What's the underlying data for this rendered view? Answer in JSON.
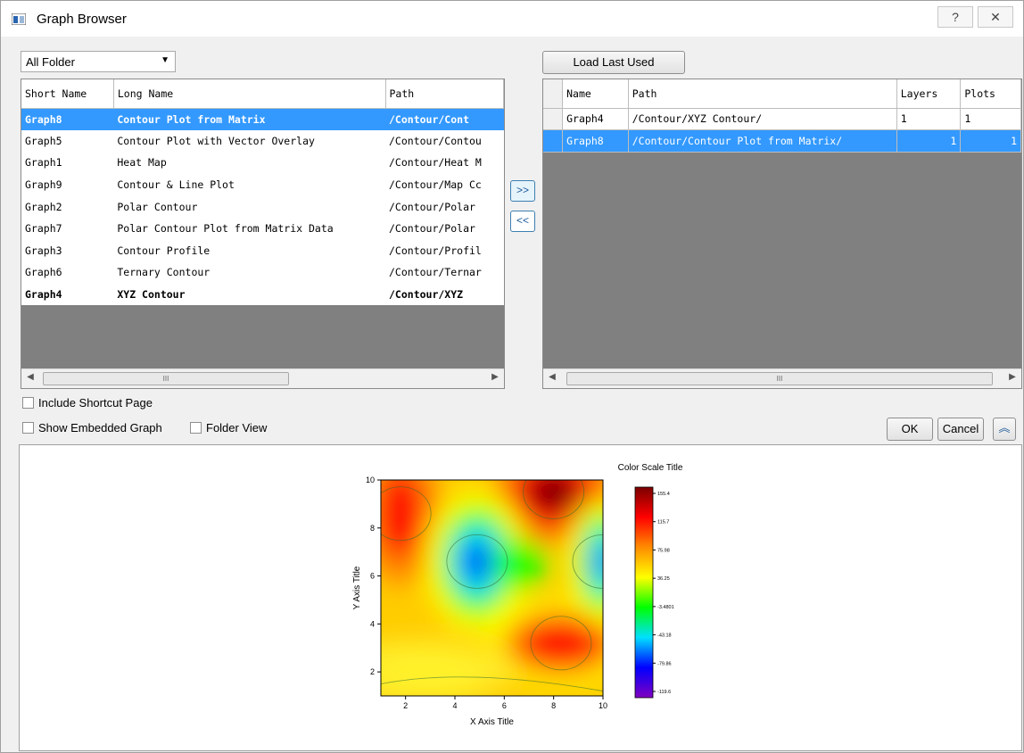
{
  "window": {
    "title": "Graph Browser",
    "help_label": "?",
    "close_label": "✕"
  },
  "folder_select": {
    "value": "All Folder"
  },
  "load_last_used": "Load Last Used",
  "left_table": {
    "columns": [
      "Short Name",
      "Long Name",
      "Path"
    ],
    "rows": [
      {
        "short": "Graph8",
        "long": "Contour Plot from Matrix",
        "path": "/Contour/Cont",
        "selected": true,
        "bold": true
      },
      {
        "short": "Graph5",
        "long": "Contour Plot with Vector Overlay",
        "path": "/Contour/Contou"
      },
      {
        "short": "Graph1",
        "long": "Heat Map",
        "path": "/Contour/Heat M"
      },
      {
        "short": "Graph9",
        "long": "Contour & Line Plot",
        "path": "/Contour/Map Cc"
      },
      {
        "short": "Graph2",
        "long": "Polar Contour",
        "path": "/Contour/Polar"
      },
      {
        "short": "Graph7",
        "long": "Polar Contour Plot from Matrix Data",
        "path": "/Contour/Polar"
      },
      {
        "short": "Graph3",
        "long": "Contour Profile",
        "path": "/Contour/Profil"
      },
      {
        "short": "Graph6",
        "long": "Ternary Contour",
        "path": "/Contour/Ternar"
      },
      {
        "short": "Graph4",
        "long": "XYZ Contour",
        "path": "/Contour/XYZ",
        "bold": true
      }
    ]
  },
  "move_right_label": ">>",
  "move_left_label": "<<",
  "right_table": {
    "columns": [
      "Name",
      "Path",
      "Layers",
      "Plots"
    ],
    "rows": [
      {
        "name": "Graph4",
        "path": "/Contour/XYZ Contour/",
        "layers": "1",
        "plots": "1"
      },
      {
        "name": "Graph8",
        "path": "/Contour/Contour Plot from Matrix/",
        "layers": "1",
        "plots": "1",
        "selected": true
      }
    ]
  },
  "scroll_thumb_label": "III",
  "options": {
    "include_shortcut": "Include Shortcut Page",
    "show_embedded": "Show Embedded Graph",
    "folder_view": "Folder View"
  },
  "buttons": {
    "ok": "OK",
    "cancel": "Cancel",
    "collapse": "⌃"
  },
  "chart_data": {
    "type": "heatmap",
    "title": "",
    "xlabel": "X Axis Title",
    "ylabel": "Y Axis Title",
    "xlim": [
      1,
      10
    ],
    "ylim": [
      1,
      10
    ],
    "x_ticks": [
      "2",
      "4",
      "6",
      "8",
      "10"
    ],
    "y_ticks": [
      "2",
      "4",
      "6",
      "8",
      "10"
    ],
    "colorbar_title": "Color Scale Title",
    "colorbar_ticks": [
      "155.4",
      "115.7",
      "75.98",
      "36.25",
      "-3.4801",
      "-43.18",
      "-79.86",
      "-119.6"
    ],
    "colormap": [
      "#7a0000",
      "#ff0000",
      "#ff8c00",
      "#ffff00",
      "#00ff00",
      "#00e0ff",
      "#0000ff",
      "#8000c0"
    ],
    "features": [
      {
        "kind": "high",
        "x": 8.0,
        "y": 9.5,
        "value": 160
      },
      {
        "kind": "high",
        "x": 1.8,
        "y": 8.6,
        "value": 120
      },
      {
        "kind": "high",
        "x": 8.3,
        "y": 3.2,
        "value": 110
      },
      {
        "kind": "low",
        "x": 4.9,
        "y": 6.6,
        "value": -110
      },
      {
        "kind": "low",
        "x": 10.0,
        "y": 6.6,
        "value": -100
      },
      {
        "kind": "mid",
        "x": 6.6,
        "y": 6.5,
        "value": 5
      },
      {
        "kind": "mid",
        "x": 3.0,
        "y": 2.0,
        "value": 45
      }
    ]
  }
}
